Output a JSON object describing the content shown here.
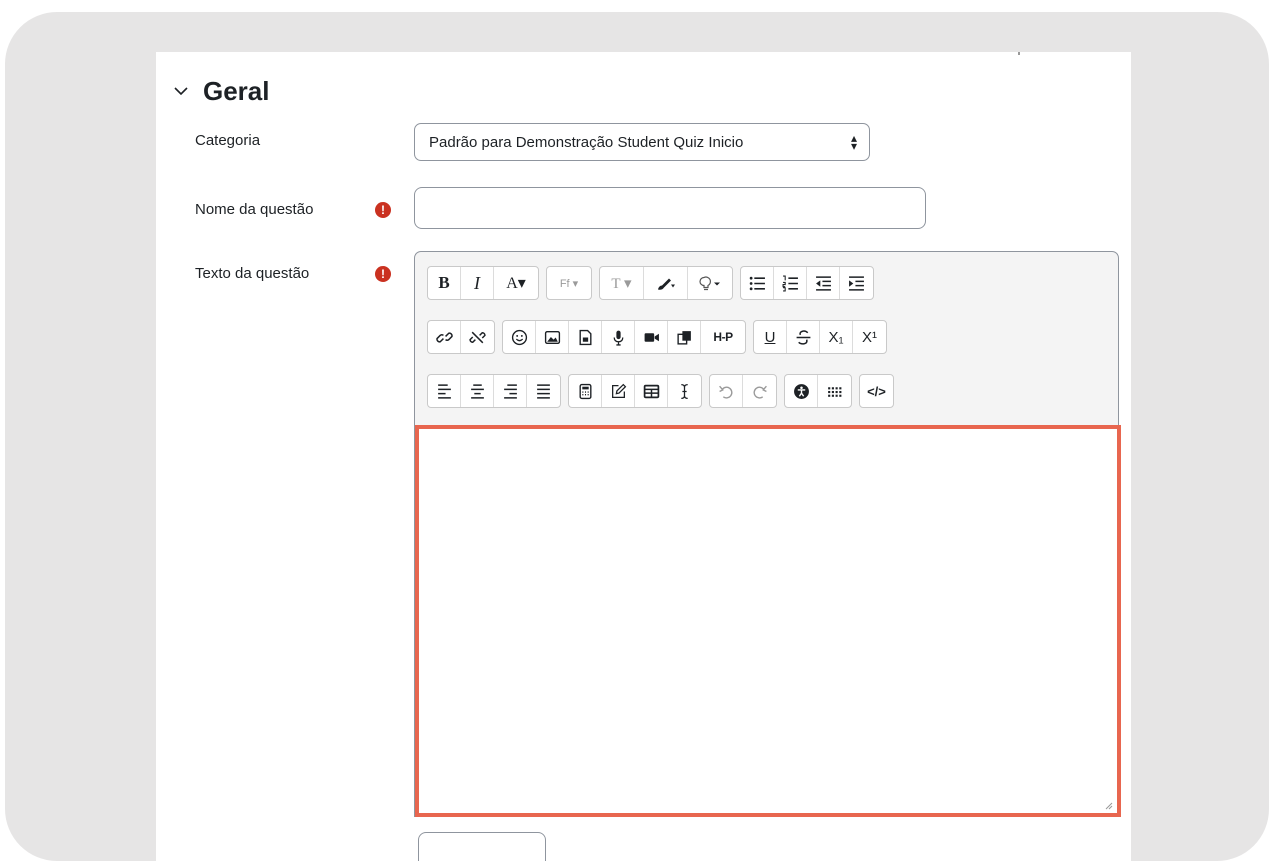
{
  "section": {
    "title": "Geral"
  },
  "fields": {
    "category": {
      "label": "Categoria",
      "value": "Padrão para Demonstração Student Quiz Inicio"
    },
    "question_name": {
      "label": "Nome da questão",
      "value": "",
      "required_mark": "!"
    },
    "question_text": {
      "label": "Texto da questão",
      "value": "",
      "required_mark": "!"
    }
  },
  "toolbar": {
    "row1": [
      [
        "bold",
        "italic",
        "font-color"
      ],
      [
        "font-family"
      ],
      [
        "font-size",
        "background-color",
        "hint"
      ],
      [
        "unordered-list",
        "ordered-list",
        "outdent",
        "indent"
      ]
    ],
    "row2": [
      [
        "link",
        "unlink"
      ],
      [
        "emoji",
        "image",
        "media",
        "record-audio",
        "record-video",
        "copy",
        "h5p"
      ],
      [
        "underline",
        "strikethrough",
        "subscript",
        "superscript"
      ]
    ],
    "row3": [
      [
        "align-left",
        "align-center",
        "align-right",
        "align-justify"
      ],
      [
        "calculator",
        "edit",
        "table",
        "cursor"
      ],
      [
        "undo",
        "redo"
      ],
      [
        "accessibility",
        "special-characters"
      ],
      [
        "html"
      ]
    ],
    "labels": {
      "bold": "B",
      "italic": "I",
      "font_color": "A▾",
      "font_family": "Ff ▾",
      "font_size": "T ▾",
      "subscript": "X₁",
      "superscript": "X¹",
      "h5p": "H-P",
      "html": "</>",
      "underline": "U"
    }
  },
  "colors": {
    "highlight": "#e8664f",
    "required": "#ca3120",
    "frame": "#e6e5e5"
  }
}
